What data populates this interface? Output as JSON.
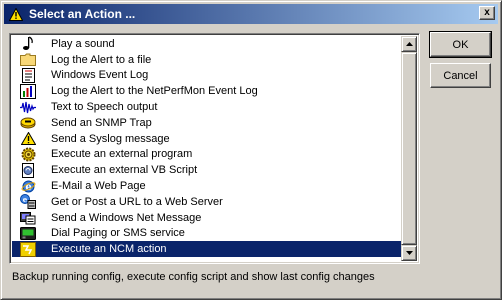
{
  "window": {
    "title": "Select an Action ...",
    "title_icon": "warning-triangle-icon",
    "close_label": "x"
  },
  "actions": [
    {
      "label": "Play a sound",
      "icon": "music-note-icon",
      "selected": false
    },
    {
      "label": "Log the Alert to a file",
      "icon": "folder-icon",
      "selected": false
    },
    {
      "label": "Windows Event Log",
      "icon": "event-log-icon",
      "selected": false
    },
    {
      "label": "Log the Alert to the NetPerfMon Event Log",
      "icon": "netperfmon-log-icon",
      "selected": false
    },
    {
      "label": "Text to Speech output",
      "icon": "sound-wave-icon",
      "selected": false
    },
    {
      "label": "Send an SNMP Trap",
      "icon": "snmp-trap-icon",
      "selected": false
    },
    {
      "label": "Send a Syslog message",
      "icon": "syslog-triangle-icon",
      "selected": false
    },
    {
      "label": "Execute an external program",
      "icon": "gear-icon",
      "selected": false
    },
    {
      "label": "Execute an external VB Script",
      "icon": "script-icon",
      "selected": false
    },
    {
      "label": "E-Mail a Web Page",
      "icon": "ie-globe-icon",
      "selected": false
    },
    {
      "label": "Get or Post a URL to a Web Server",
      "icon": "web-server-icon",
      "selected": false
    },
    {
      "label": "Send a Windows Net Message",
      "icon": "net-message-icon",
      "selected": false
    },
    {
      "label": "Dial Paging or SMS service",
      "icon": "pager-icon",
      "selected": false
    },
    {
      "label": "Execute an NCM action",
      "icon": "ncm-action-icon",
      "selected": true
    }
  ],
  "buttons": {
    "ok_label": "OK",
    "cancel_label": "Cancel"
  },
  "status": {
    "description": "Backup running config, execute config script and show last config changes"
  },
  "colors": {
    "titlebar_start": "#0a246a",
    "titlebar_end": "#a6caf0",
    "selection": "#0a246a",
    "face": "#d4d0c8"
  }
}
